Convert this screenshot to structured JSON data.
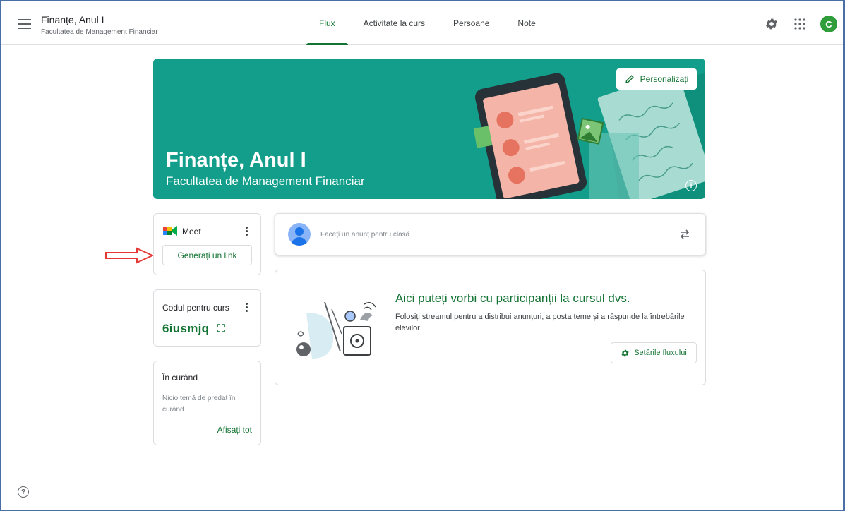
{
  "header": {
    "class_title": "Finanțe, Anul I",
    "class_subtitle": "Facultatea de Management Financiar",
    "tabs": [
      {
        "label": "Flux",
        "active": true
      },
      {
        "label": "Activitate la curs",
        "active": false
      },
      {
        "label": "Persoane",
        "active": false
      },
      {
        "label": "Note",
        "active": false
      }
    ],
    "avatar_letter": "C",
    "icons": [
      "menu-icon",
      "settings-icon",
      "apps-grid-icon"
    ]
  },
  "banner": {
    "title": "Finanțe, Anul I",
    "subtitle": "Facultatea de Management Financiar",
    "customize_label": "Personalizați",
    "info_glyph": "i",
    "color": "#129e8a"
  },
  "meet": {
    "label": "Meet",
    "button_label": "Generați un link"
  },
  "class_code": {
    "label": "Codul pentru curs",
    "value": "6iusmjq"
  },
  "upcoming": {
    "title": "În curând",
    "text": "Nicio temă de predat în curând",
    "view_all_label": "Afișați tot"
  },
  "announce": {
    "placeholder": "Faceți un anunț pentru clasă"
  },
  "stream_info": {
    "title": "Aici puteți vorbi cu participanții la cursul dvs.",
    "description": "Folosiți streamul pentru a distribui anunțuri, a posta teme și a răspunde la întrebările elevilor",
    "settings_label": "Setările fluxului"
  },
  "help_glyph": "?",
  "colors": {
    "accent": "#137333",
    "annotation_arrow": "#e53935"
  }
}
